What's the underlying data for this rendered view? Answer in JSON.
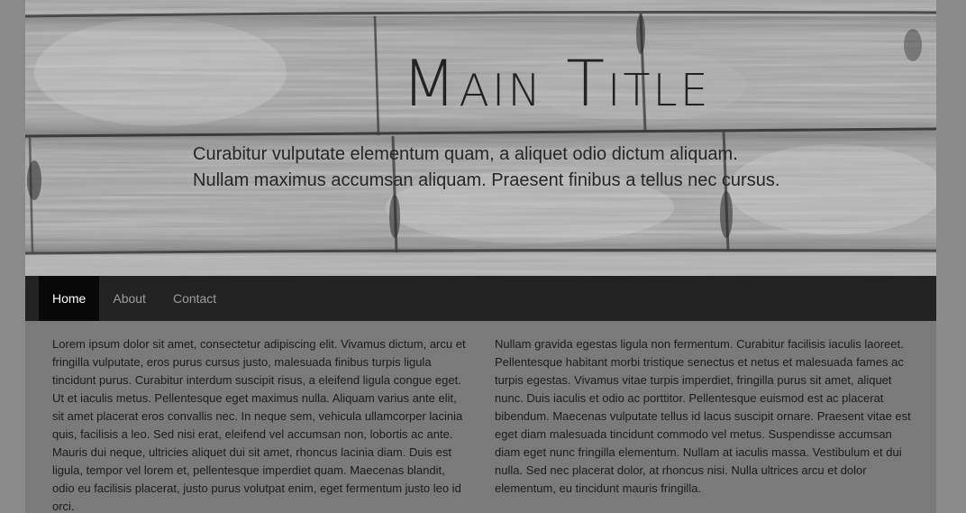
{
  "hero": {
    "title": "Main Title",
    "subtitle": "Curabitur vulputate elementum quam, a aliquet odio dictum aliquam. Nullam maximus accumsan aliquam. Praesent finibus a tellus nec cursus."
  },
  "nav": {
    "items": [
      {
        "label": "Home",
        "active": true
      },
      {
        "label": "About",
        "active": false
      },
      {
        "label": "Contact",
        "active": false
      }
    ]
  },
  "content": {
    "left_text": "Lorem ipsum dolor sit amet, consectetur adipiscing elit. Vivamus dictum, arcu et fringilla vulputate, eros purus cursus justo, malesuada finibus turpis ligula tincidunt purus. Curabitur interdum suscipit risus, a eleifend ligula congue eget. Ut et iaculis metus. Pellentesque eget maximus nulla. Aliquam varius ante elit, sit amet placerat eros convallis nec. In neque sem, vehicula ullamcorper lacinia quis, facilisis a leo. Sed nisi erat, eleifend vel accumsan non, lobortis ac ante. Mauris dui neque, ultricies aliquet dui sit amet, rhoncus lacinia diam. Duis est ligula, tempor vel lorem et, pellentesque imperdiet quam. Maecenas blandit, odio eu facilisis placerat, justo purus volutpat enim, eget fermentum justo leo id orci.",
    "right_text": "Nullam gravida egestas ligula non fermentum. Curabitur facilisis iaculis laoreet. Pellentesque habitant morbi tristique senectus et netus et malesuada fames ac turpis egestas. Vivamus vitae turpis imperdiet, fringilla purus sit amet, aliquet nunc. Duis iaculis et odio ac porttitor. Pellentesque euismod est ac placerat bibendum. Maecenas vulputate tellus id lacus suscipit ornare. Praesent vitae est eget diam malesuada tincidunt commodo vel metus. Suspendisse accumsan diam eget nunc fringilla elementum. Nullam at iaculis massa. Vestibulum et dui nulla. Sed nec placerat dolor, at rhoncus nisi. Nulla ultrices arcu et dolor elementum, eu tincidunt mauris fringilla."
  },
  "colors": {
    "page_background": "#8a8a8a",
    "content_background": "#7a7a7a",
    "nav_background": "#222222",
    "nav_active_background": "#080808",
    "nav_text": "#9d9d9d",
    "nav_active_text": "#ffffff"
  }
}
